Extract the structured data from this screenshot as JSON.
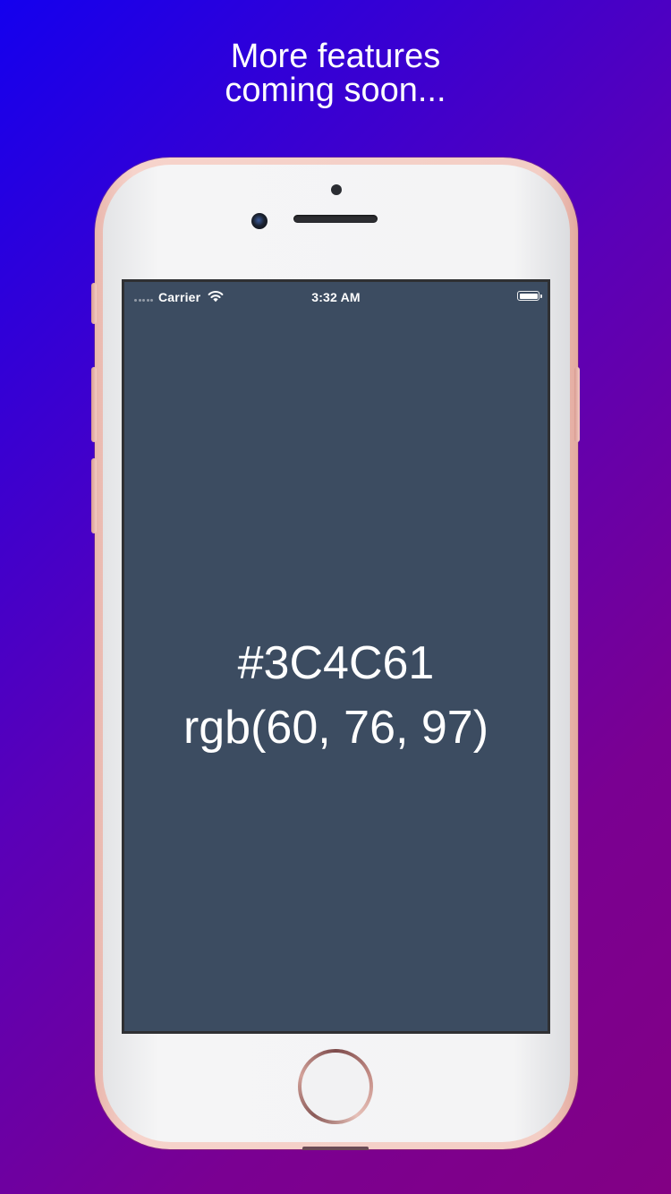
{
  "promo": {
    "line1": "More features",
    "line2": "coming soon..."
  },
  "status_bar": {
    "carrier": "Carrier",
    "time": "3:32 AM",
    "battery_level": 1.0,
    "icons": [
      "signal-dots-icon",
      "wifi-icon",
      "battery-icon"
    ]
  },
  "color": {
    "hex": "#3C4C61",
    "rgb": "rgb(60, 76, 97)"
  },
  "colors": {
    "background_start": "#1400ee",
    "background_end": "#820084",
    "screen_background": "#3c4c61",
    "phone_frame": "#f3cec5"
  }
}
